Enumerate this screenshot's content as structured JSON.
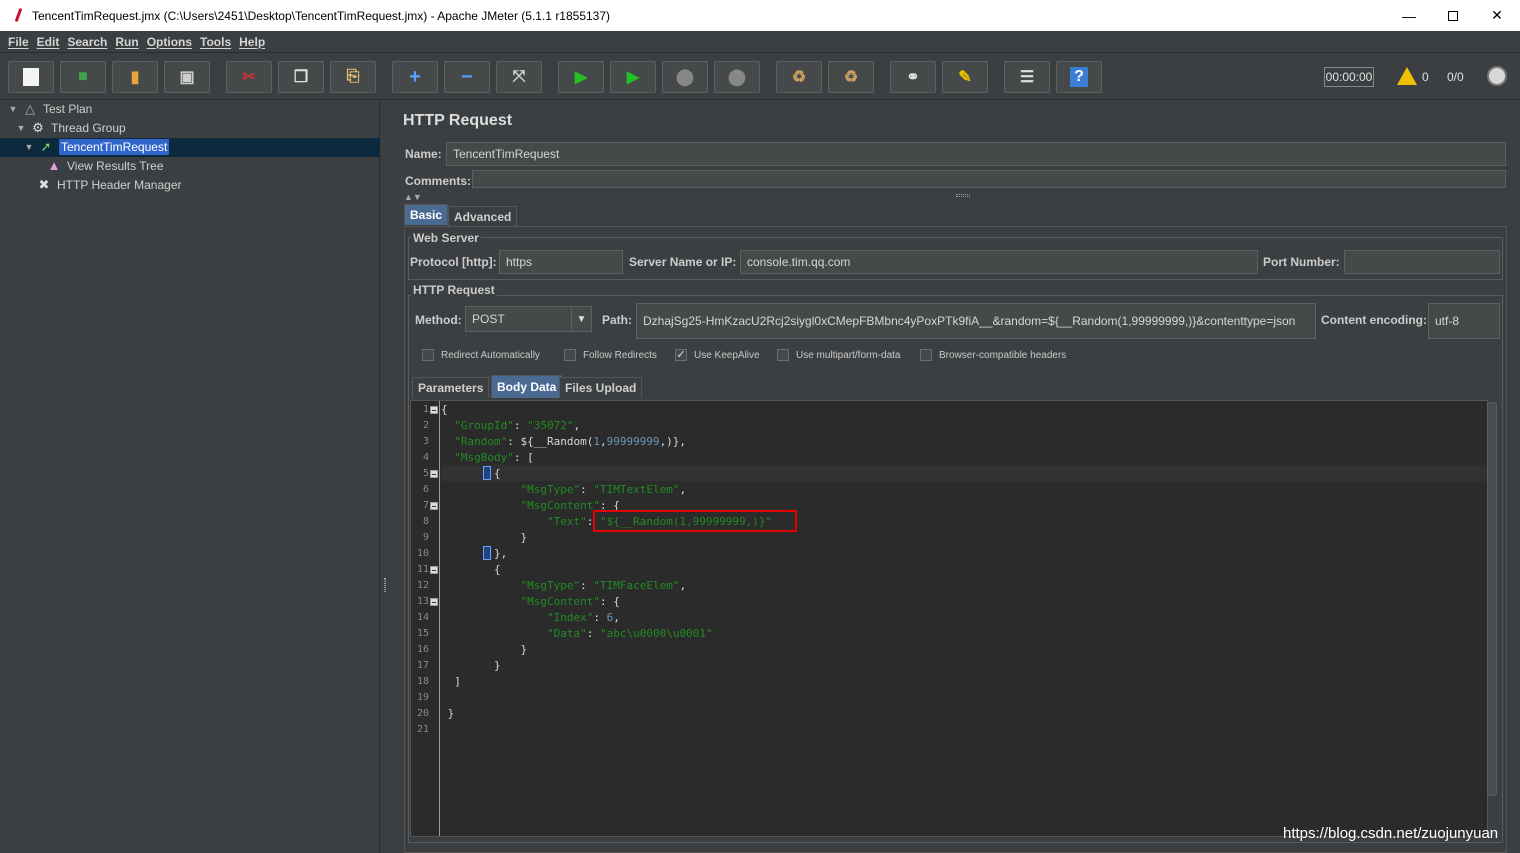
{
  "window": {
    "title": "TencentTimRequest.jmx (C:\\Users\\2451\\Desktop\\TencentTimRequest.jmx) - Apache JMeter (5.1.1 r1855137)"
  },
  "menu": [
    "File",
    "Edit",
    "Search",
    "Run",
    "Options",
    "Tools",
    "Help"
  ],
  "toolbar": {
    "timer": "00:00:00",
    "warnings": "0",
    "threads": "0/0",
    "icons": [
      "new-icon",
      "templates-icon",
      "open-icon",
      "save-icon",
      "cut-icon",
      "copy-icon",
      "paste-icon",
      "expand-icon",
      "collapse-icon",
      "toggle-icon",
      "start-icon",
      "start-no-pause-icon",
      "stop-icon",
      "shutdown-icon",
      "clear-icon",
      "clear-all-icon",
      "search-icon",
      "reset-search-icon",
      "function-helper-icon",
      "help-icon"
    ]
  },
  "tree": {
    "items": [
      {
        "label": "Test Plan",
        "icon": "test-plan-icon"
      },
      {
        "label": "Thread Group",
        "icon": "gear-icon"
      },
      {
        "label": "TencentTimRequest",
        "icon": "pipette-icon"
      },
      {
        "label": "View Results Tree",
        "icon": "graph-icon"
      },
      {
        "label": "HTTP Header Manager",
        "icon": "wrench-icon"
      }
    ]
  },
  "sampler": {
    "title": "HTTP Request",
    "name_label": "Name:",
    "name_value": "TencentTimRequest",
    "comments_label": "Comments:",
    "tabs": [
      "Basic",
      "Advanced"
    ],
    "web_server": {
      "title": "Web Server",
      "protocol_label": "Protocol [http]:",
      "protocol_value": "https",
      "server_label": "Server Name or IP:",
      "server_value": "console.tim.qq.com",
      "port_label": "Port Number:",
      "port_value": ""
    },
    "http_request": {
      "title": "HTTP Request",
      "method_label": "Method:",
      "method_value": "POST",
      "path_label": "Path:",
      "path_value": "DzhajSg25-HmKzacU2Rcj2siygl0xCMepFBMbnc4yPoxPTk9fiA__&random=${__Random(1,99999999,)}&contenttype=json",
      "encoding_label": "Content encoding:",
      "encoding_value": "utf-8"
    },
    "checkboxes": [
      {
        "label": "Redirect Automatically",
        "checked": false
      },
      {
        "label": "Follow Redirects",
        "checked": false
      },
      {
        "label": "Use KeepAlive",
        "checked": true
      },
      {
        "label": "Use multipart/form-data",
        "checked": false
      },
      {
        "label": "Browser-compatible headers",
        "checked": false
      }
    ],
    "body_tabs": [
      "Parameters",
      "Body Data",
      "Files Upload"
    ]
  },
  "editor": {
    "line_numbers": [
      "1",
      "2",
      "3",
      "4",
      "5",
      "6",
      "7",
      "8",
      "9",
      "10",
      "11",
      "12",
      "13",
      "14",
      "15",
      "16",
      "17",
      "18",
      "19",
      "20",
      "21"
    ],
    "lines": [
      [
        [
          "p",
          "{"
        ]
      ],
      [
        [
          "p",
          "  "
        ],
        [
          "k",
          "\"GroupId\""
        ],
        [
          "p",
          ": "
        ],
        [
          "k",
          "\"35072\""
        ],
        [
          "p",
          ","
        ]
      ],
      [
        [
          "p",
          "  "
        ],
        [
          "k",
          "\"Random\""
        ],
        [
          "p",
          ": ${__Random("
        ],
        [
          "n",
          "1"
        ],
        [
          "p",
          ","
        ],
        [
          "n",
          "99999999"
        ],
        [
          "p",
          ",)},"
        ]
      ],
      [
        [
          "p",
          "  "
        ],
        [
          "k",
          "\"MsgBody\""
        ],
        [
          "p",
          ": ["
        ]
      ],
      [
        [
          "p",
          "        {"
        ]
      ],
      [
        [
          "p",
          "            "
        ],
        [
          "k",
          "\"MsgType\""
        ],
        [
          "p",
          ": "
        ],
        [
          "k",
          "\"TIMTextElem\""
        ],
        [
          "p",
          ","
        ]
      ],
      [
        [
          "p",
          "            "
        ],
        [
          "k",
          "\"MsgContent\""
        ],
        [
          "p",
          ": {"
        ]
      ],
      [
        [
          "p",
          "                "
        ],
        [
          "k",
          "\"Text\""
        ],
        [
          "p",
          ": "
        ],
        [
          "k",
          "\"${__Random(1,99999999,)}\""
        ]
      ],
      [
        [
          "p",
          "            }"
        ]
      ],
      [
        [
          "p",
          "        },"
        ]
      ],
      [
        [
          "p",
          "        {"
        ]
      ],
      [
        [
          "p",
          "            "
        ],
        [
          "k",
          "\"MsgType\""
        ],
        [
          "p",
          ": "
        ],
        [
          "k",
          "\"TIMFaceElem\""
        ],
        [
          "p",
          ","
        ]
      ],
      [
        [
          "p",
          "            "
        ],
        [
          "k",
          "\"MsgContent\""
        ],
        [
          "p",
          ": {"
        ]
      ],
      [
        [
          "p",
          "                "
        ],
        [
          "k",
          "\"Index\""
        ],
        [
          "p",
          ": "
        ],
        [
          "n",
          "6"
        ],
        [
          "p",
          ","
        ]
      ],
      [
        [
          "p",
          "                "
        ],
        [
          "k",
          "\"Data\""
        ],
        [
          "p",
          ": "
        ],
        [
          "k",
          "\"abc\\u0000\\u0001\""
        ]
      ],
      [
        [
          "p",
          "            }"
        ]
      ],
      [
        [
          "p",
          "        }"
        ]
      ],
      [
        [
          "p",
          "  ]"
        ]
      ],
      [
        [
          "p",
          ""
        ]
      ],
      [
        [
          "p",
          " }"
        ]
      ],
      [
        [
          "p",
          ""
        ]
      ]
    ]
  },
  "watermark": "https://blog.csdn.net/zuojunyuan"
}
